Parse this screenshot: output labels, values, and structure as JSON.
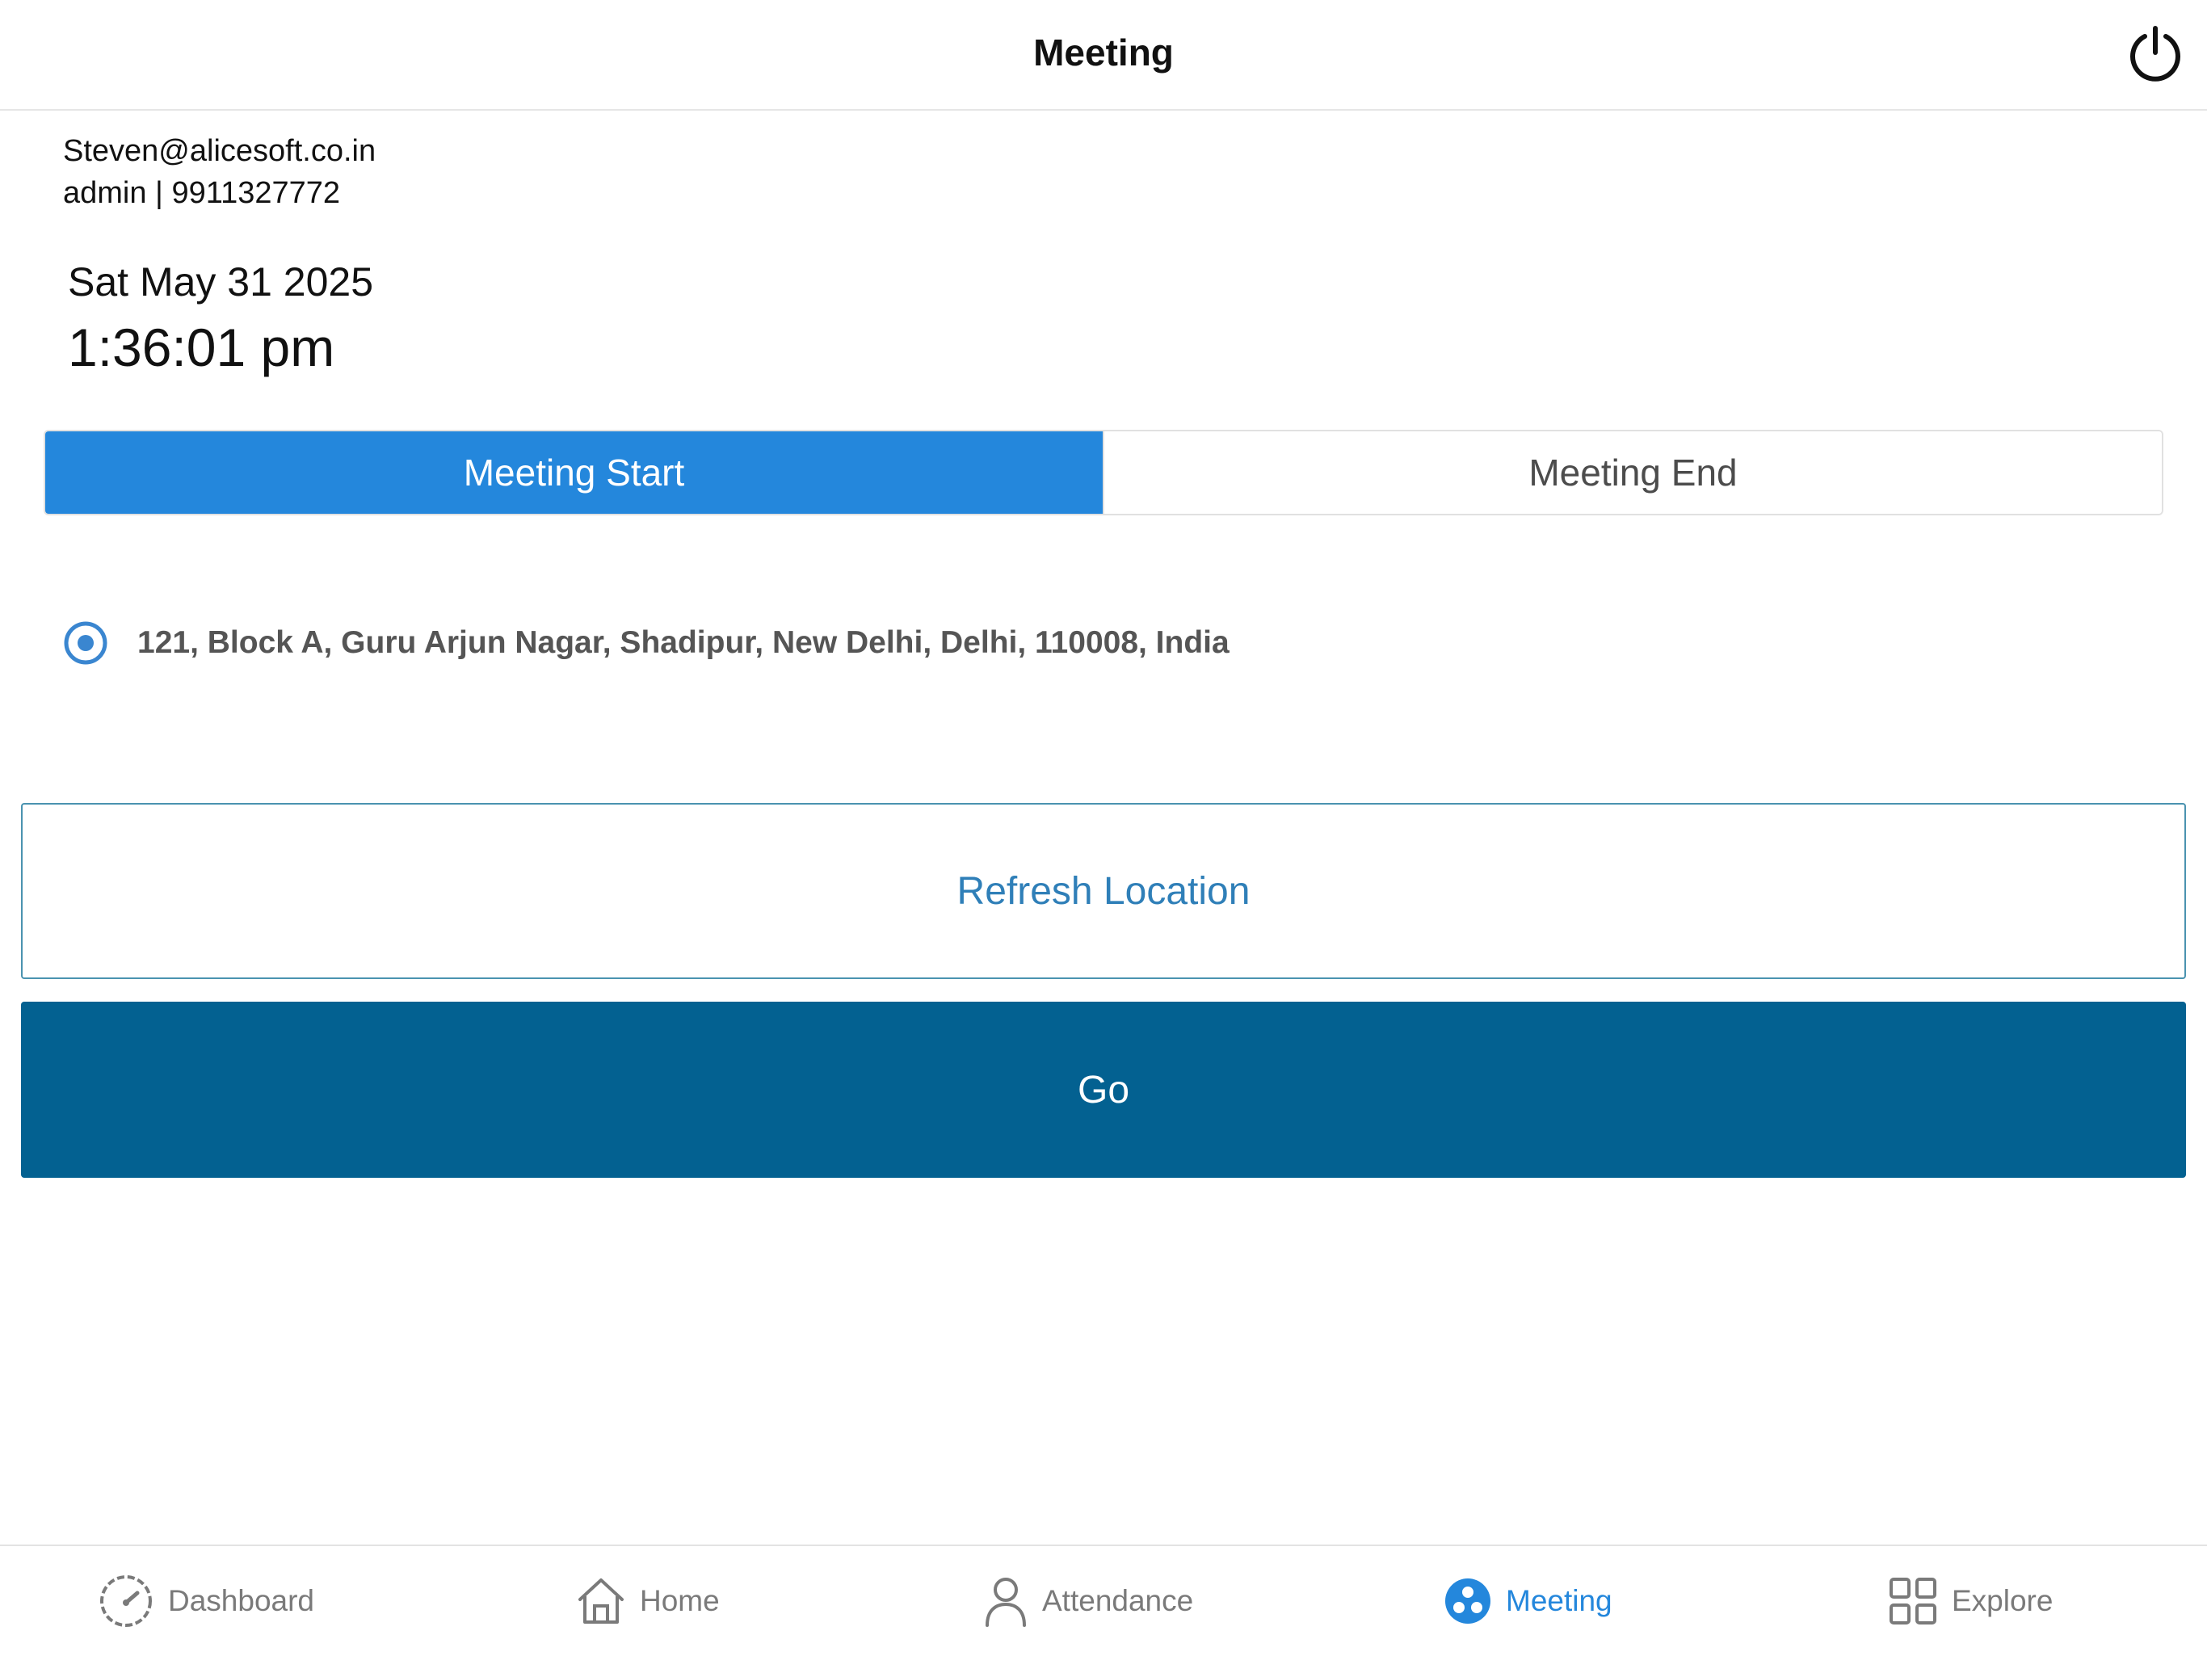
{
  "header": {
    "title": "Meeting"
  },
  "user": {
    "email": "Steven@alicesoft.co.in",
    "role_phone": "admin | 9911327772"
  },
  "datetime": {
    "date": "Sat May 31 2025",
    "time": "1:36:01 pm"
  },
  "segmented": {
    "start_label": "Meeting Start",
    "end_label": "Meeting End",
    "selected": "Meeting Start"
  },
  "location": {
    "address": "121, Block A, Guru Arjun Nagar, Shadipur, New Delhi, Delhi, 110008, India"
  },
  "actions": {
    "refresh_label": "Refresh Location",
    "go_label": "Go"
  },
  "tabbar": {
    "items": [
      {
        "label": "Dashboard",
        "icon": "gauge-icon"
      },
      {
        "label": "Home",
        "icon": "home-icon"
      },
      {
        "label": "Attendance",
        "icon": "person-icon"
      },
      {
        "label": "Meeting",
        "icon": "meeting-icon"
      },
      {
        "label": "Explore",
        "icon": "grid-icon"
      }
    ],
    "active": "Meeting"
  },
  "colors": {
    "accent": "#2487dc",
    "primary_button": "#036191",
    "refresh_text": "#2f7fb8"
  }
}
